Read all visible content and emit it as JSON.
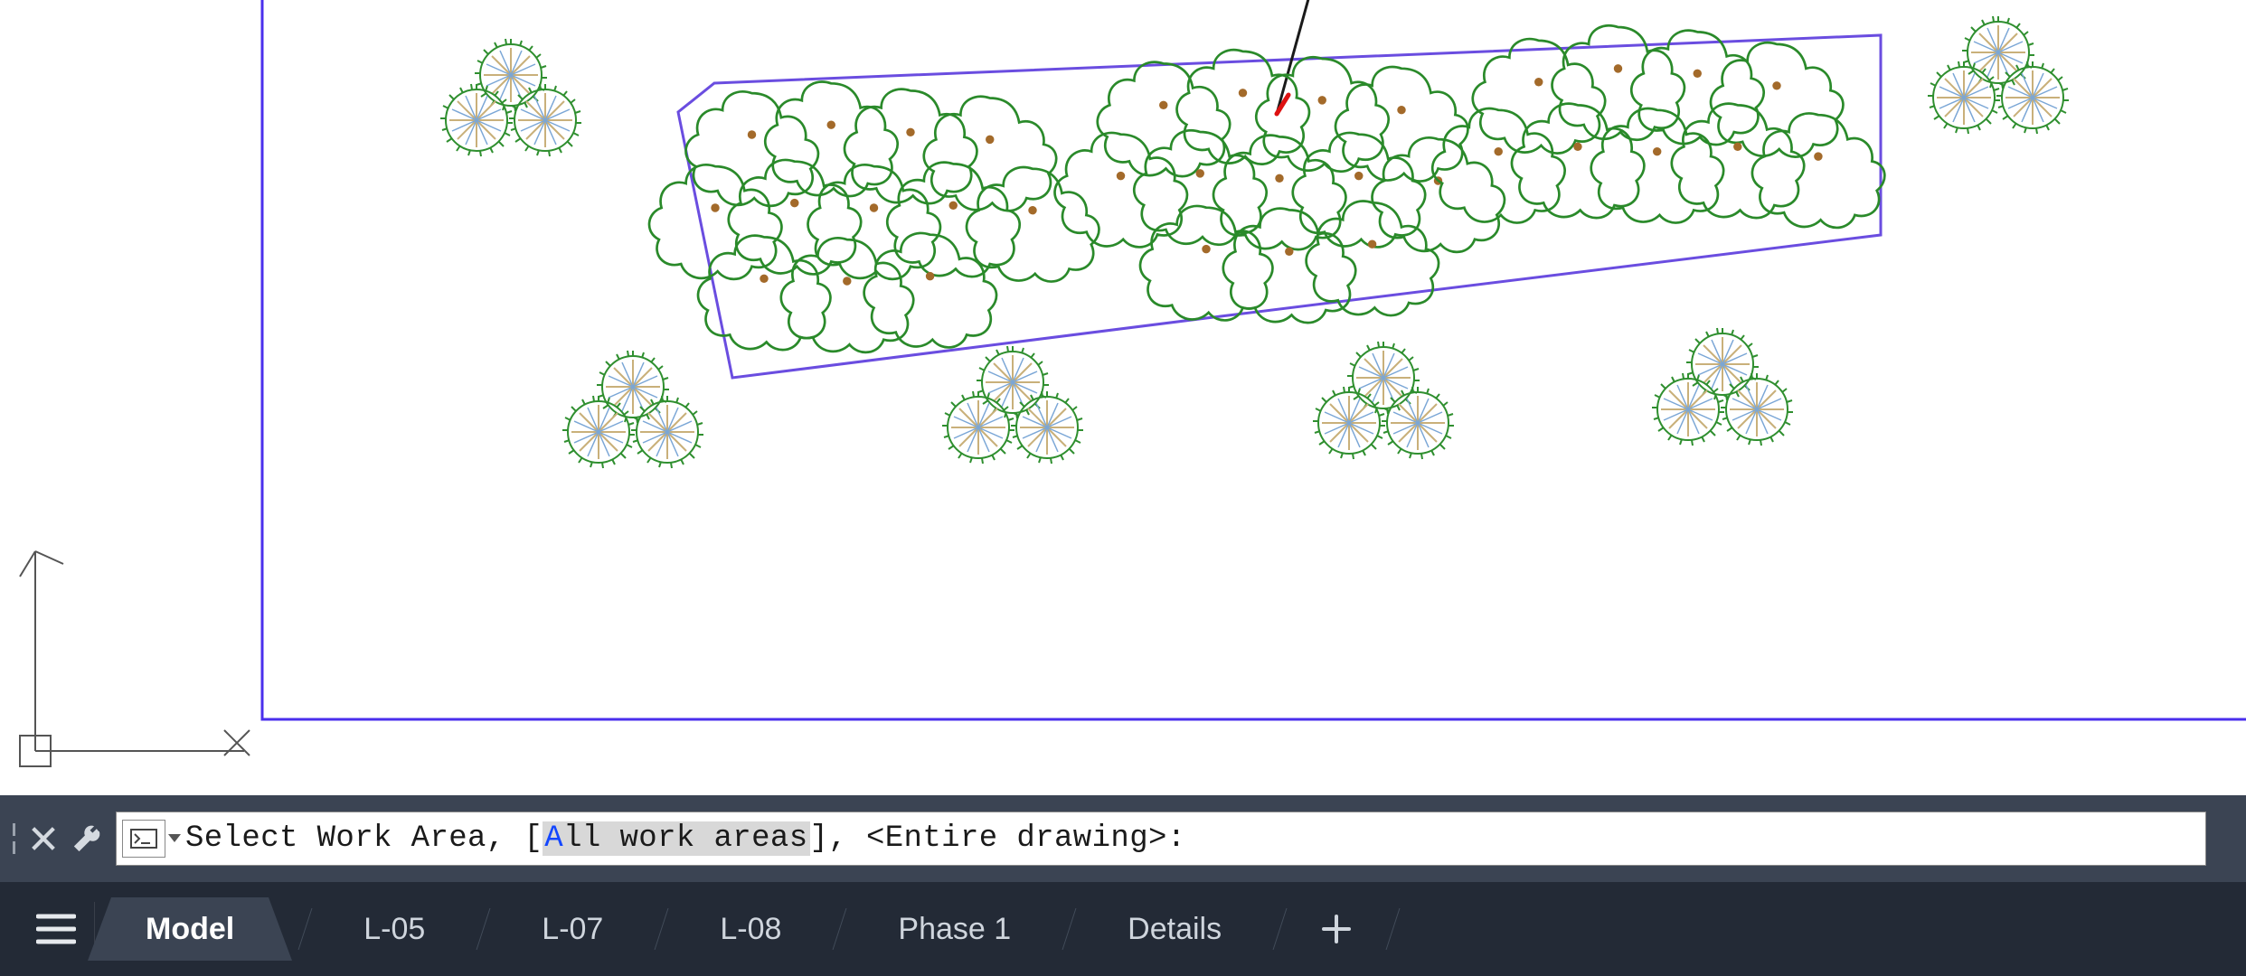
{
  "commandline": {
    "prompt_prefix": "Select Work Area, [",
    "option_hotkey": "A",
    "option_rest": "ll work areas",
    "prompt_mid": "], <",
    "default_value": "Entire drawing",
    "prompt_suffix": ">:"
  },
  "tabs": {
    "active": "Model",
    "items": [
      "Model",
      "L-05",
      "L-07",
      "L-08",
      "Phase 1",
      "Details"
    ]
  },
  "icons": {
    "close": "close-icon",
    "wrench": "wrench-icon",
    "menu": "hamburger-icon",
    "plus": "plus-icon",
    "cmd_dropdown": "chevron-down-icon",
    "cmd_prefix": "terminal-icon"
  },
  "drawing": {
    "frame_color": "#4a2fed",
    "shrub_stroke": "#2a8a2a",
    "shrub_dot": "#a36a2a",
    "grass_stroke": "#2f8f2f",
    "grass_inner": "#c9b07a",
    "leader_color": "#1a1a1a",
    "leader_tip": "#d11"
  }
}
